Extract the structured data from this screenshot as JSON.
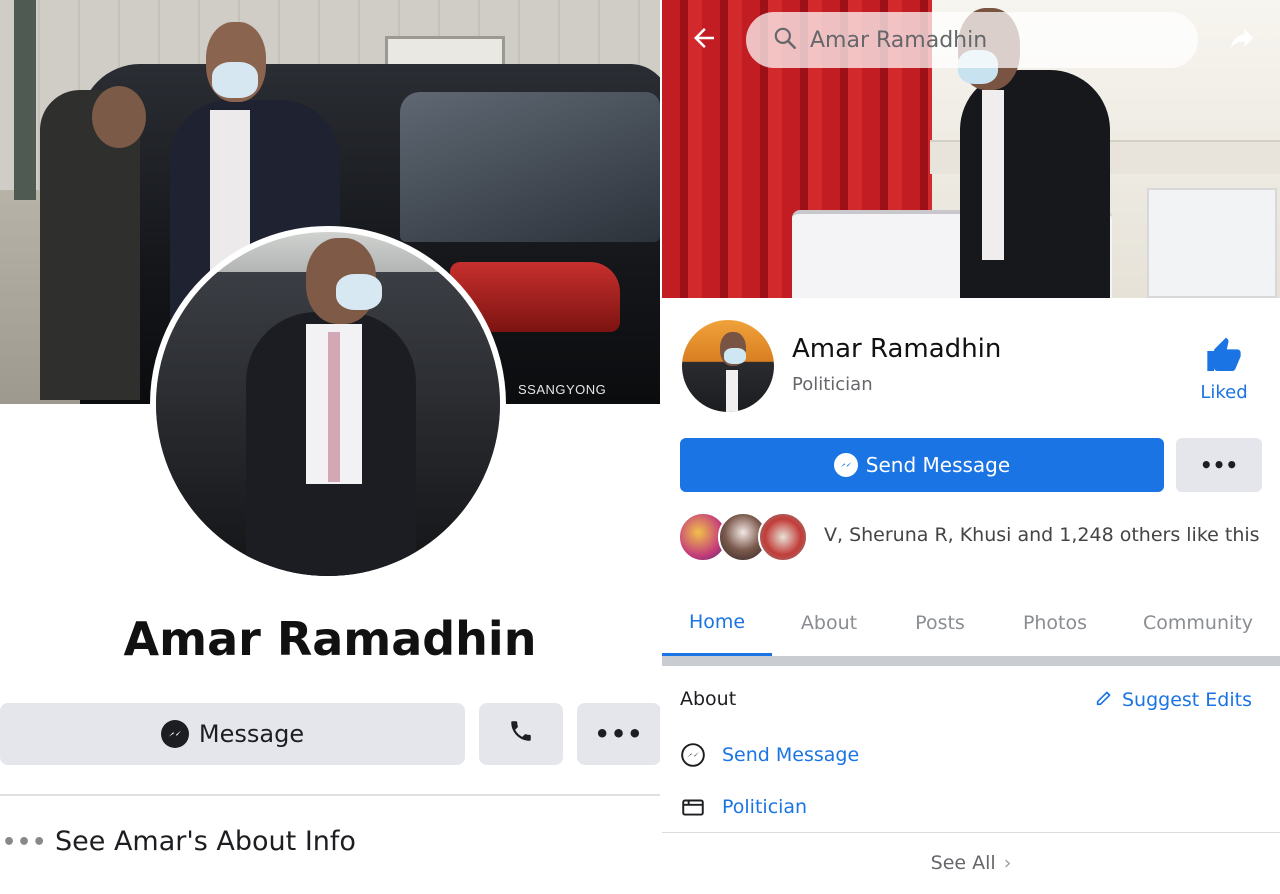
{
  "left": {
    "cover_brand": "SSANGYONG",
    "name": "Amar Ramadhin",
    "message_label": "Message",
    "more_label": "•••",
    "about_dots": "•••",
    "about_info": "See Amar's About Info"
  },
  "right": {
    "search_text": "Amar Ramadhin",
    "name": "Amar Ramadhin",
    "category": "Politician",
    "liked_label": "Liked",
    "send_message_label": "Send Message",
    "more_label": "•••",
    "likes_text": "V, Sheruna R, Khusi and 1,248 others like this",
    "tabs": [
      {
        "label": "Home",
        "active": true
      },
      {
        "label": "About",
        "active": false
      },
      {
        "label": "Posts",
        "active": false
      },
      {
        "label": "Photos",
        "active": false
      },
      {
        "label": "Community",
        "active": false
      }
    ],
    "about_section": {
      "heading": "About",
      "suggest_edits": "Suggest Edits",
      "rows": [
        {
          "icon": "messenger-icon",
          "text": "Send Message"
        },
        {
          "icon": "category-icon",
          "text": "Politician"
        }
      ],
      "see_all": "See All",
      "see_all_chevron": "›"
    }
  },
  "colors": {
    "accent": "#1b74e4",
    "button_gray": "#e4e6eb",
    "text_primary": "#1c1e21",
    "text_secondary": "#65676b"
  }
}
